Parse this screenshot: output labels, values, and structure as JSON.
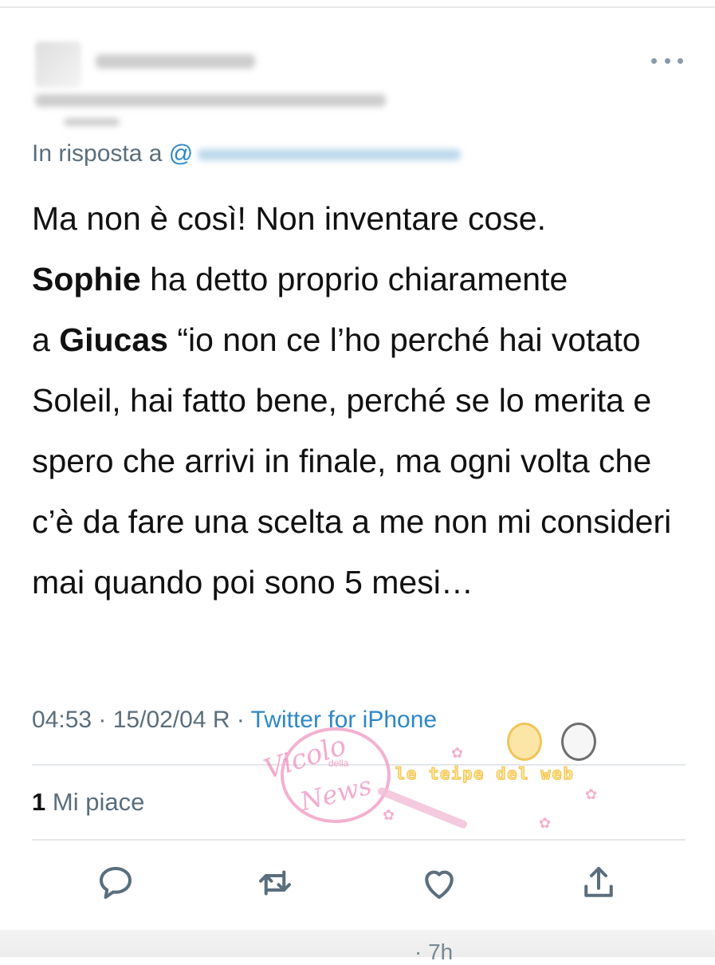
{
  "tweet": {
    "reply_prefix": "In risposta a",
    "reply_handle": "@",
    "text_line1": "Ma non è così! Non inventare cose.",
    "bold1": "Sophie",
    "text_line2": " ha detto proprio chiaramente",
    "line3_prefix": "a ",
    "bold2": "Giucas",
    "text_line3": " “io non ce l’ho perché hai votato Soleil, hai fatto bene, perché se lo merita e spero che arrivi in finale, ma ogni volta che c’è da fare una scelta a me non mi consideri mai quando poi sono 5 mesi…",
    "timestamp": "04:53 · 15/02/04 R · ",
    "source": "Twitter for iPhone",
    "likes_count": "1",
    "likes_label": "Mi piace"
  },
  "actions": [
    {
      "name": "reply",
      "icon": "speech-bubble-icon"
    },
    {
      "name": "retweet",
      "icon": "retweet-icon"
    },
    {
      "name": "like",
      "icon": "heart-icon"
    },
    {
      "name": "share",
      "icon": "share-icon"
    }
  ],
  "watermark": {
    "script_top": "Vicolo",
    "small": "della",
    "script_bottom": "News",
    "banner": "le teipe del web"
  },
  "footer": {
    "partial": "· 7h"
  },
  "colors": {
    "link": "#2d88c7",
    "secondary_text": "#5b6e7c",
    "watermark_pink": "#f08fbf"
  }
}
